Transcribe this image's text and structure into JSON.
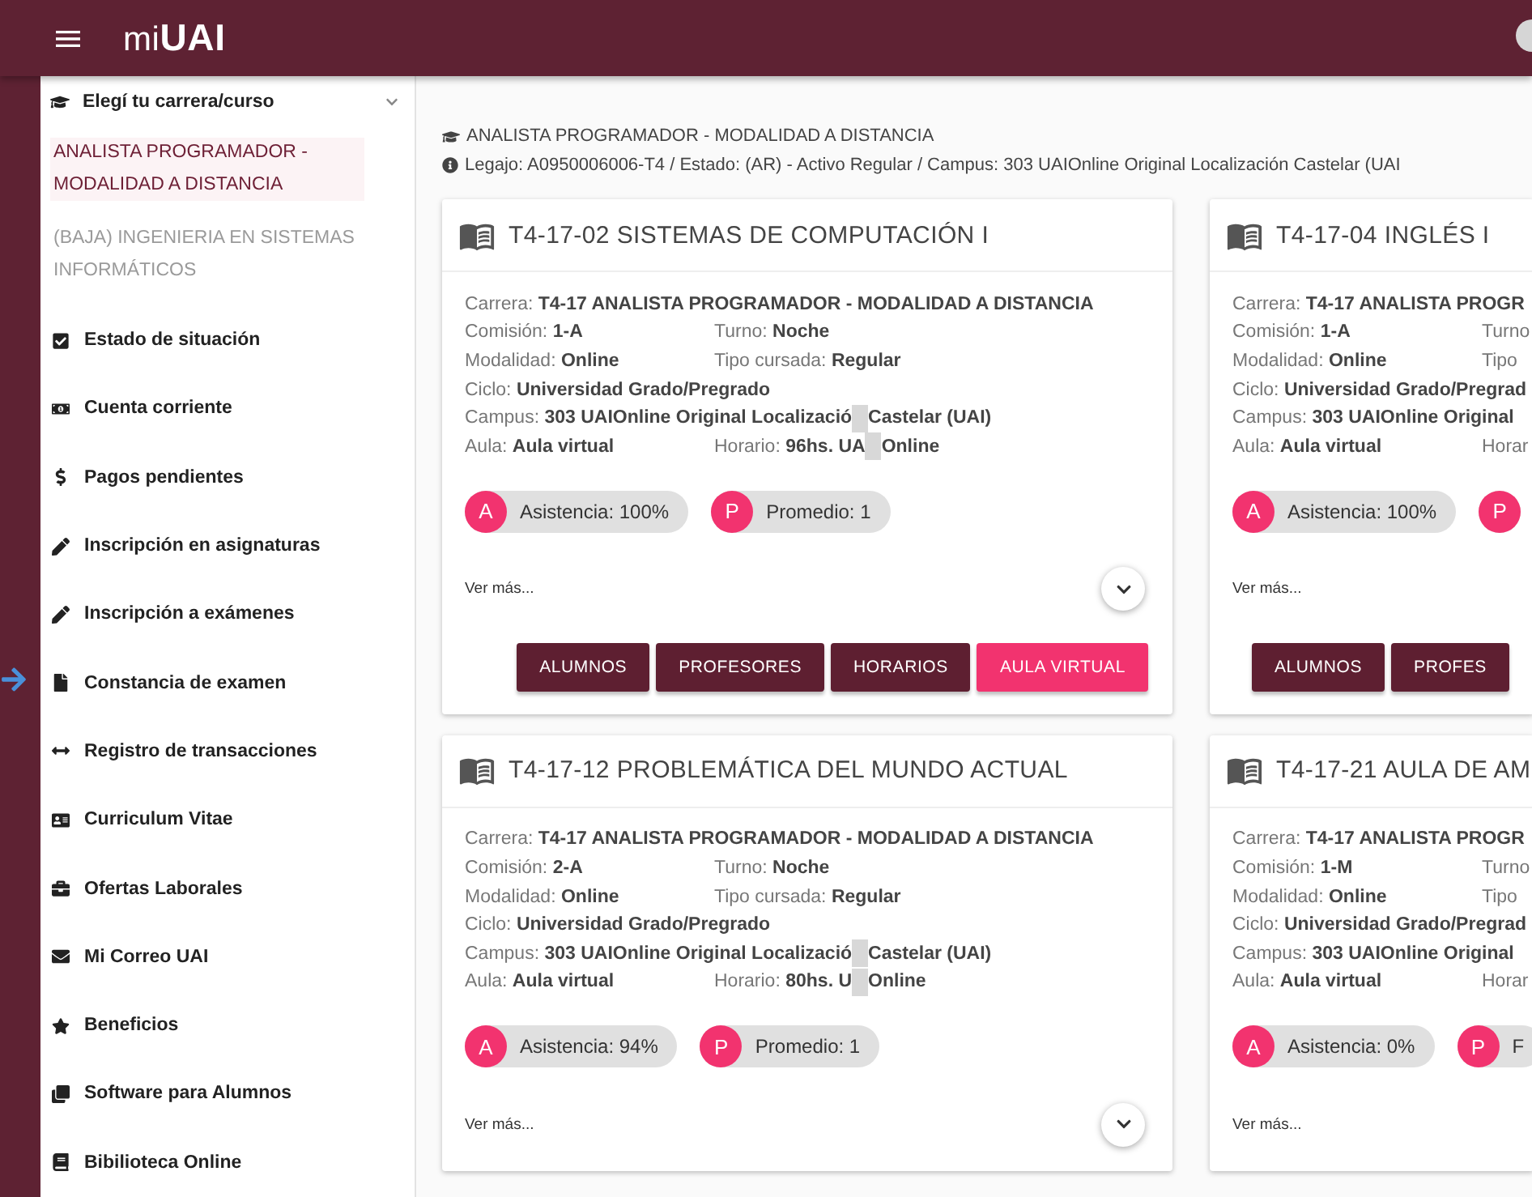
{
  "topbar": {
    "logo_prefix": "mi",
    "logo_brand": "UAI"
  },
  "sidebar": {
    "career_picker": {
      "label": "Elegí tu carrera/curso",
      "expanded": true,
      "options": [
        {
          "label": "ANALISTA PROGRAMADOR - MODALIDAD A DISTANCIA",
          "selected": true
        },
        {
          "label": "(BAJA) INGENIERIA EN SISTEMAS INFORMÁTICOS",
          "selected": false
        }
      ]
    },
    "items": [
      "Estado de situación",
      "Cuenta corriente",
      "Pagos pendientes",
      "Inscripción en asignaturas",
      "Inscripción a exámenes",
      "Constancia de examen",
      "Registro de transacciones",
      "Curriculum Vitae",
      "Ofertas Laborales",
      "Mi Correo UAI",
      "Beneficios",
      "Software para Alumnos",
      "Bibilioteca Online"
    ]
  },
  "header": {
    "career": "ANALISTA PROGRAMADOR - MODALIDAD A DISTANCIA",
    "info": "Legajo: A0950006006-T4 / Estado: (AR) - Activo Regular / Campus: 303 UAIOnline Original Localización Castelar (UAI"
  },
  "cards": [
    {
      "title": "T4-17-02 SISTEMAS DE COMPUTACIÓN I",
      "rows": [
        [
          {
            "label": "Carrera:",
            "value": "T4-17 ANALISTA PROGRAMADOR - MODALIDAD A DISTANCIA"
          }
        ],
        [
          {
            "label": "Comisión:",
            "value": "1-A"
          },
          {
            "label": "Turno:",
            "value": "Noche"
          }
        ],
        [
          {
            "label": "Modalidad:",
            "value": "Online"
          },
          {
            "label": "Tipo cursada:",
            "value": "Regular"
          }
        ],
        [
          {
            "label": "Ciclo:",
            "value": "Universidad Grado/Pregrado"
          }
        ],
        [
          {
            "label": "Campus:",
            "value": "303 UAIOnline Original Localizació",
            "redacted": true,
            "value_after": "Castelar (UAI)"
          }
        ],
        [
          {
            "label": "Aula:",
            "value": "Aula virtual"
          },
          {
            "label": "Horario:",
            "value": "96hs. UA",
            "redacted": true,
            "value_after": "Online"
          }
        ]
      ],
      "chips": [
        {
          "letter": "A",
          "text": "Asistencia: 100%"
        },
        {
          "letter": "P",
          "text": "Promedio: 1"
        }
      ],
      "more": {
        "label": "Ver más...",
        "chevron": true
      },
      "buttons": [
        {
          "label": "ALUMNOS",
          "kind": "primary"
        },
        {
          "label": "PROFESORES",
          "kind": "primary"
        },
        {
          "label": "HORARIOS",
          "kind": "primary"
        },
        {
          "label": "AULA VIRTUAL",
          "kind": "accent"
        }
      ]
    },
    {
      "title": "T4-17-04 INGLÉS I",
      "rows": [
        [
          {
            "label": "Carrera:",
            "value": "T4-17 ANALISTA PROGR"
          }
        ],
        [
          {
            "label": "Comisión:",
            "value": "1-A"
          },
          {
            "label": "Turno"
          }
        ],
        [
          {
            "label": "Modalidad:",
            "value": "Online"
          },
          {
            "label": "Tipo"
          }
        ],
        [
          {
            "label": "Ciclo:",
            "value": "Universidad Grado/Pregrad"
          }
        ],
        [
          {
            "label": "Campus:",
            "value": "303 UAIOnline Original"
          }
        ],
        [
          {
            "label": "Aula:",
            "value": "Aula virtual"
          },
          {
            "label": "Horar"
          }
        ]
      ],
      "chips": [
        {
          "letter": "A",
          "text": "Asistencia: 100%"
        },
        {
          "letter": "P"
        }
      ],
      "more": {
        "label": "Ver más..."
      },
      "buttons": [
        {
          "label": "ALUMNOS",
          "kind": "primary"
        },
        {
          "label": "PROFES",
          "kind": "primary"
        }
      ]
    },
    {
      "title": "T4-17-12 PROBLEMÁTICA DEL MUNDO ACTUAL",
      "rows": [
        [
          {
            "label": "Carrera:",
            "value": "T4-17 ANALISTA PROGRAMADOR - MODALIDAD A DISTANCIA"
          }
        ],
        [
          {
            "label": "Comisión:",
            "value": "2-A"
          },
          {
            "label": "Turno:",
            "value": "Noche"
          }
        ],
        [
          {
            "label": "Modalidad:",
            "value": "Online"
          },
          {
            "label": "Tipo cursada:",
            "value": "Regular"
          }
        ],
        [
          {
            "label": "Ciclo:",
            "value": "Universidad Grado/Pregrado"
          }
        ],
        [
          {
            "label": "Campus:",
            "value": "303 UAIOnline Original Localizació",
            "redacted": true,
            "value_after": "Castelar (UAI)"
          }
        ],
        [
          {
            "label": "Aula:",
            "value": "Aula virtual"
          },
          {
            "label": "Horario:",
            "value": "80hs. U",
            "redacted": true,
            "value_after": "Online"
          }
        ]
      ],
      "chips": [
        {
          "letter": "A",
          "text": "Asistencia: 94%"
        },
        {
          "letter": "P",
          "text": "Promedio: 1"
        }
      ],
      "more": {
        "label": "Ver más...",
        "chevron": true
      }
    },
    {
      "title": "T4-17-21 AULA DE AM",
      "rows": [
        [
          {
            "label": "Carrera:",
            "value": "T4-17 ANALISTA PROGR"
          }
        ],
        [
          {
            "label": "Comisión:",
            "value": "1-M"
          },
          {
            "label": "Turno"
          }
        ],
        [
          {
            "label": "Modalidad:",
            "value": "Online"
          },
          {
            "label": "Tipo"
          }
        ],
        [
          {
            "label": "Ciclo:",
            "value": "Universidad Grado/Pregrad"
          }
        ],
        [
          {
            "label": "Campus:",
            "value": "303 UAIOnline Original"
          }
        ],
        [
          {
            "label": "Aula:",
            "value": "Aula virtual"
          },
          {
            "label": "Horar"
          }
        ]
      ],
      "chips": [
        {
          "letter": "A",
          "text": "Asistencia: 0%"
        },
        {
          "letter": "P",
          "text": "F"
        }
      ],
      "more": {
        "label": "Ver más..."
      }
    }
  ]
}
